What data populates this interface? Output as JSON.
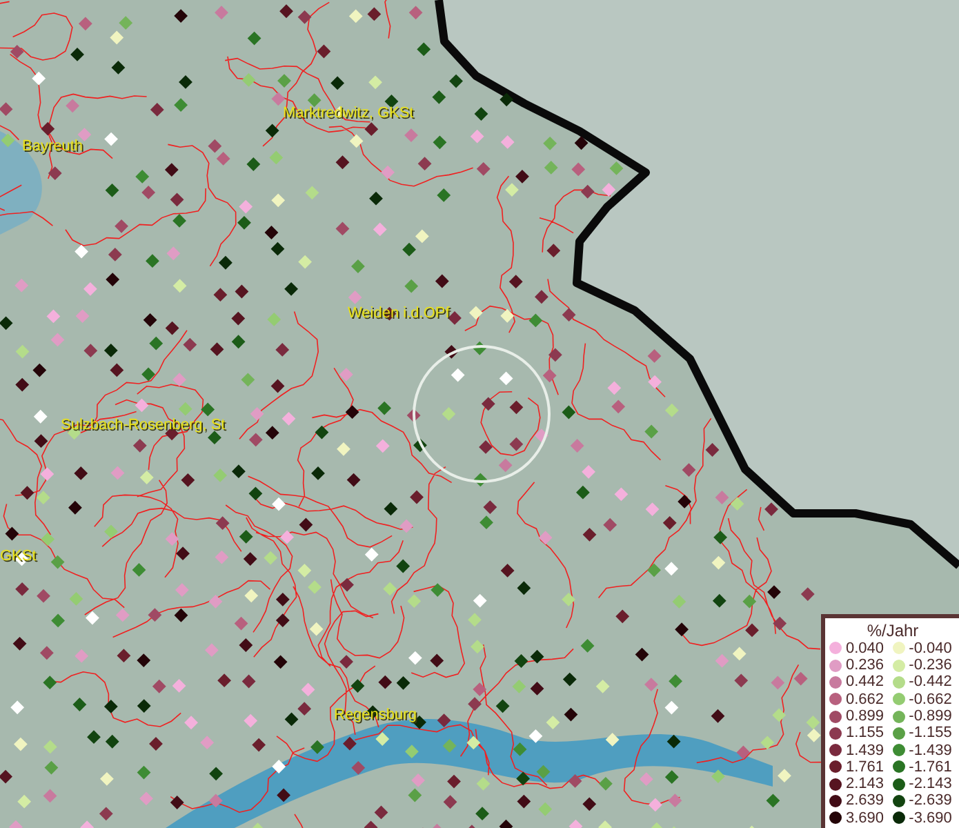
{
  "map": {
    "places": [
      {
        "name": "Marktredwitz, GKSt"
      },
      {
        "name": "Bayreuth"
      },
      {
        "name": "Weiden i.d.OPf"
      },
      {
        "name": "Sulzbach-Rosenberg, St"
      },
      {
        "name": "GKSt"
      },
      {
        "name": "Regensburg"
      }
    ]
  },
  "legend": {
    "title": "%/Jahr",
    "rows": [
      {
        "positive": {
          "label": "0.040",
          "color": "#f4b0dc"
        },
        "negative": {
          "label": "-0.040",
          "color": "#f0f4c0"
        }
      },
      {
        "positive": {
          "label": "0.236",
          "color": "#e09cc4"
        },
        "negative": {
          "label": "-0.236",
          "color": "#d4eca4"
        }
      },
      {
        "positive": {
          "label": "0.442",
          "color": "#c87a9e"
        },
        "negative": {
          "label": "-0.442",
          "color": "#b4dc8a"
        }
      },
      {
        "positive": {
          "label": "0.662",
          "color": "#b8607e"
        },
        "negative": {
          "label": "-0.662",
          "color": "#94cc72"
        }
      },
      {
        "positive": {
          "label": "0.899",
          "color": "#a04a64"
        },
        "negative": {
          "label": "-0.899",
          "color": "#74b45a"
        }
      },
      {
        "positive": {
          "label": "1.155",
          "color": "#8c3a50"
        },
        "negative": {
          "label": "-1.155",
          "color": "#5aa046"
        }
      },
      {
        "positive": {
          "label": "1.439",
          "color": "#7a2a3e"
        },
        "negative": {
          "label": "-1.439",
          "color": "#3e8c34"
        }
      },
      {
        "positive": {
          "label": "1.761",
          "color": "#6a1e2c"
        },
        "negative": {
          "label": "-1.761",
          "color": "#2a7424"
        }
      },
      {
        "positive": {
          "label": "2.143",
          "color": "#561420"
        },
        "negative": {
          "label": "-2.143",
          "color": "#1c5c18"
        }
      },
      {
        "positive": {
          "label": "2.639",
          "color": "#420c16"
        },
        "negative": {
          "label": "-2.639",
          "color": "#124410"
        }
      },
      {
        "positive": {
          "label": "3.690",
          "color": "#240408"
        },
        "negative": {
          "label": "-3.690",
          "color": "#0a2a08"
        }
      }
    ]
  }
}
